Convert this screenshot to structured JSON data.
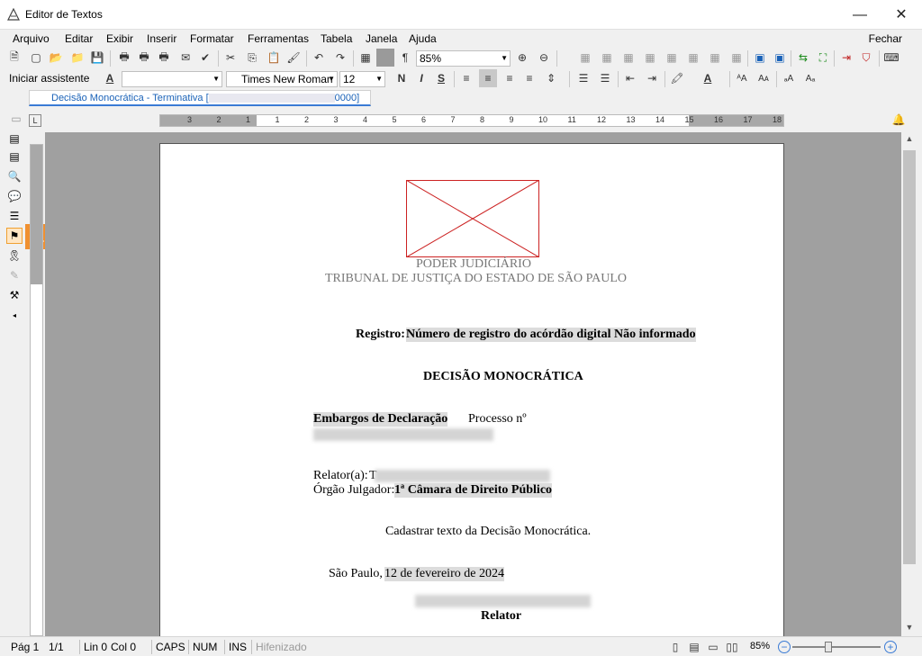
{
  "window": {
    "title": "Editor de Textos",
    "minimize": "—",
    "restore": "☐",
    "close": "✕"
  },
  "menu": {
    "items": [
      "Arquivo",
      "Editar",
      "Exibir",
      "Inserir",
      "Formatar",
      "Ferramentas",
      "Tabela",
      "Janela",
      "Ajuda"
    ],
    "close_label": "Fechar"
  },
  "toolbar": {
    "zoom_value": "85%",
    "wizard_label": "Iniciar assistente",
    "style_value": "",
    "font_value": "Times New Roman",
    "size_value": "12"
  },
  "doc_tab": {
    "label_start": "Decisão Monocrática - Terminativa [",
    "label_end": "0000]"
  },
  "ruler": {
    "numbers": [
      "3",
      "2",
      "1",
      "1",
      "2",
      "3",
      "4",
      "5",
      "6",
      "7",
      "8",
      "9",
      "10",
      "11",
      "12",
      "13",
      "14",
      "15",
      "16",
      "17",
      "18"
    ]
  },
  "sidebar": {
    "badge": "1"
  },
  "document": {
    "header_line1": "PODER JUDICIÁRIO",
    "header_line2": "TRIBUNAL DE JUSTIÇA DO ESTADO DE SÃO PAULO",
    "registro_label": "Registro:",
    "registro_value": "Número de registro do acórdão digital Não informado",
    "heading": "DECISÃO MONOCRÁTICA",
    "embargos_label": "Embargos de Declaração",
    "processo_label": "Processo nº",
    "relator_label": "Relator(a):",
    "relator_initial": "T",
    "orgao_label": "Órgão Julgador:",
    "orgao_value": "1ª Câmara de Direito Público",
    "body_text": "Cadastrar texto da Decisão Monocrática.",
    "city": "São Paulo,",
    "date": "12 de fevereiro de 2024",
    "date_end": ".",
    "signature_role": "Relator"
  },
  "status": {
    "page": "Pág 1",
    "pages": "1/1",
    "line": "Lin 0",
    "col": "Col 0",
    "caps": "CAPS",
    "num": "NUM",
    "ins": "INS",
    "hyphen": "Hifenizado",
    "zoom": "85%"
  },
  "colors": {
    "accent": "#3a7bd5",
    "badge": "#f09030",
    "logo_border": "#cc2222"
  }
}
